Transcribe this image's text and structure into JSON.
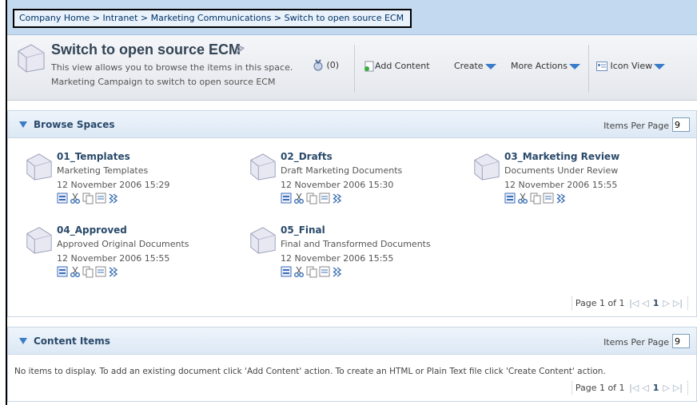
{
  "breadcrumb": {
    "home": "Company Home",
    "intranet": "Intranet",
    "marketing": "Marketing Communications",
    "current": "Switch to open source ECM",
    "separator": " > "
  },
  "header": {
    "title": "Switch to open source ECM",
    "description_line1": "This view allows you to browse the items in this space.",
    "description_line2": "Marketing Campaign to switch to open source ECM",
    "badge_count": "(0)",
    "add_content": "Add Content",
    "create": "Create",
    "more_actions": "More Actions",
    "view_mode": "Icon View"
  },
  "browse_spaces": {
    "title": "Browse Spaces",
    "items_per_page_label": "Items Per Page",
    "items_per_page_value": "9",
    "items": [
      {
        "name": "01_Templates",
        "description": "Marketing Templates",
        "date": "12 November 2006 15:29"
      },
      {
        "name": "02_Drafts",
        "description": "Draft Marketing Documents",
        "date": "12 November 2006 15:30"
      },
      {
        "name": "03_Marketing Review",
        "description": "Documents Under Review",
        "date": "12 November 2006 15:55"
      },
      {
        "name": "04_Approved",
        "description": "Approved Original Documents",
        "date": "12 November 2006 15:55"
      },
      {
        "name": "05_Final",
        "description": "Final and Transformed Documents",
        "date": "12 November 2006 15:55"
      }
    ],
    "pager": {
      "label": "Page 1 of 1",
      "current": "1"
    }
  },
  "content_items": {
    "title": "Content Items",
    "items_per_page_label": "Items Per Page",
    "items_per_page_value": "9",
    "empty_message": "No items to display. To add an existing document click 'Add Content' action. To create an HTML or Plain Text file click 'Create Content' action.",
    "pager": {
      "label": "Page 1 of 1",
      "current": "1"
    }
  },
  "icons": {
    "space": "folder-space-icon",
    "details": "details-icon",
    "cut": "cut-icon",
    "copy": "copy-icon",
    "preview": "preview-icon",
    "more": "more-actions-icon"
  },
  "colors": {
    "accent": "#3a7cc8",
    "title": "#2a4a6b",
    "breadcrumb_bar": "#c3d9ef"
  }
}
